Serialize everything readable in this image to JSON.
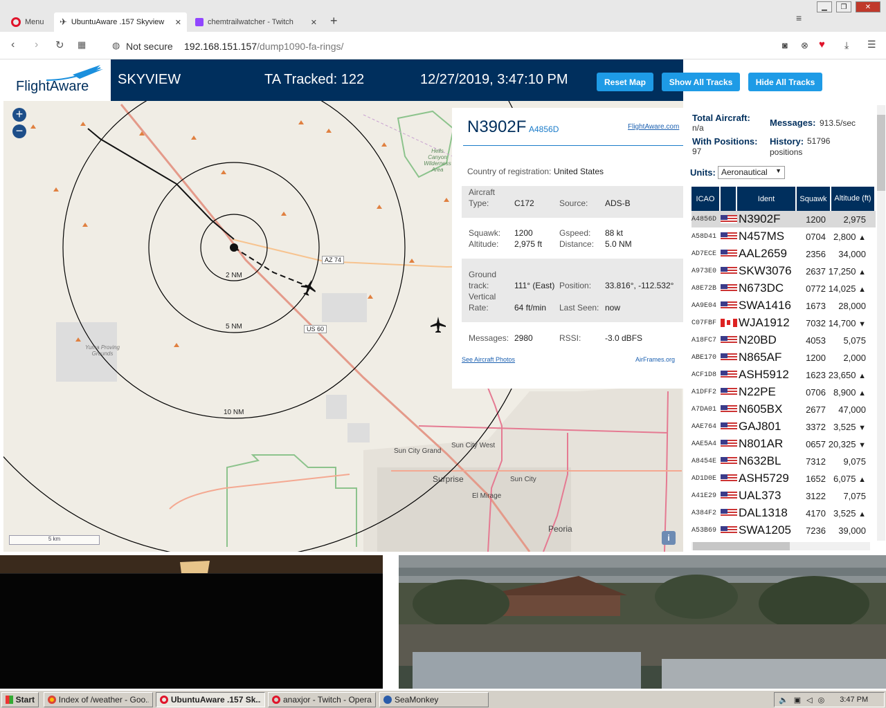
{
  "browser": {
    "menu_label": "Menu",
    "tabs": [
      {
        "label": "UbuntuAware .157 Skyview",
        "active": true
      },
      {
        "label": "chemtrailwatcher - Twitch",
        "active": false
      }
    ],
    "security_label": "Not secure",
    "url_host": "192.168.151.157",
    "url_path": "/dump1090-fa-rings/"
  },
  "header": {
    "logo_text": "FlightAware",
    "title": "SKYVIEW",
    "tracked": "TA Tracked: 122",
    "datetime": "12/27/2019, 3:47:10 PM",
    "buttons": [
      "Reset Map",
      "Show All Tracks",
      "Hide All Tracks"
    ]
  },
  "map": {
    "labels": [
      "2 NM",
      "5 NM",
      "10 NM",
      "AZ 74",
      "US 60",
      "Sun City Grand",
      "Sun City West",
      "Surprise",
      "Sun City",
      "El Mirage",
      "Peoria",
      "Hells Canyon Wilderness Area",
      "Yuma Proving Grounds"
    ],
    "scale": "5 km",
    "info_btn": "i"
  },
  "popup": {
    "callsign": "N3902F",
    "hex": "A4856D",
    "fa_link": "FlightAware.com",
    "country_label": "Country of registration:",
    "country": "United States",
    "aircraft_label": "Aircraft",
    "type_label": "Type:",
    "type": "C172",
    "source_label": "Source:",
    "source": "ADS-B",
    "squawk_label": "Squawk:",
    "squawk": "1200",
    "gspeed_label": "Gspeed:",
    "gspeed": "88 kt",
    "altitude_label": "Altitude:",
    "altitude": "2,975 ft",
    "distance_label": "Distance:",
    "distance": "5.0 NM",
    "ground_label": "Ground",
    "track_label": "track:",
    "track": "111° (East)",
    "position_label": "Position:",
    "position": "33.816°, -112.532°",
    "vertical_label": "Vertical",
    "rate_label": "Rate:",
    "rate": "64 ft/min",
    "lastseen_label": "Last Seen:",
    "lastseen": "now",
    "messages_label": "Messages:",
    "messages": "2980",
    "rssi_label": "RSSI:",
    "rssi": "-3.0 dBFS",
    "photos_link": "See Aircraft Photos",
    "airframes_link": "AirFrames.org"
  },
  "sidebar": {
    "total_label": "Total Aircraft:",
    "total": "n/a",
    "messages_label": "Messages:",
    "messages": "913.5/sec",
    "withpos_label": "With Positions:",
    "withpos": "97",
    "history_label": "History:",
    "history": "51796",
    "history_unit": "positions",
    "units_label": "Units:",
    "units_value": "Aeronautical",
    "columns": [
      "ICAO",
      "",
      "Ident",
      "Squawk",
      "Altitude (ft)"
    ],
    "rows": [
      {
        "icao": "A4856D",
        "flag": "us",
        "ident": "N3902F",
        "squawk": "1200",
        "alt": "2,975",
        "trend": ""
      },
      {
        "icao": "A58D41",
        "flag": "us",
        "ident": "N457MS",
        "squawk": "0704",
        "alt": "2,800",
        "trend": "▲"
      },
      {
        "icao": "AD7ECE",
        "flag": "us",
        "ident": "AAL2659",
        "squawk": "2356",
        "alt": "34,000",
        "trend": ""
      },
      {
        "icao": "A973E0",
        "flag": "us",
        "ident": "SKW3076",
        "squawk": "2637",
        "alt": "17,250",
        "trend": "▲"
      },
      {
        "icao": "A8E72B",
        "flag": "us",
        "ident": "N673DC",
        "squawk": "0772",
        "alt": "14,025",
        "trend": "▲"
      },
      {
        "icao": "AA9E04",
        "flag": "us",
        "ident": "SWA1416",
        "squawk": "1673",
        "alt": "28,000",
        "trend": ""
      },
      {
        "icao": "C07FBF",
        "flag": "ca",
        "ident": "WJA1912",
        "squawk": "7032",
        "alt": "14,700",
        "trend": "▼"
      },
      {
        "icao": "A18FC7",
        "flag": "us",
        "ident": "N20BD",
        "squawk": "4053",
        "alt": "5,075",
        "trend": ""
      },
      {
        "icao": "ABE170",
        "flag": "us",
        "ident": "N865AF",
        "squawk": "1200",
        "alt": "2,000",
        "trend": ""
      },
      {
        "icao": "ACF1D8",
        "flag": "us",
        "ident": "ASH5912",
        "squawk": "1623",
        "alt": "23,650",
        "trend": "▲"
      },
      {
        "icao": "A1DFF2",
        "flag": "us",
        "ident": "N22PE",
        "squawk": "0706",
        "alt": "8,900",
        "trend": "▲"
      },
      {
        "icao": "A7DA01",
        "flag": "us",
        "ident": "N605BX",
        "squawk": "2677",
        "alt": "47,000",
        "trend": ""
      },
      {
        "icao": "AAE764",
        "flag": "us",
        "ident": "GAJ801",
        "squawk": "3372",
        "alt": "3,525",
        "trend": "▼"
      },
      {
        "icao": "AAE5A4",
        "flag": "us",
        "ident": "N801AR",
        "squawk": "0657",
        "alt": "20,325",
        "trend": "▼"
      },
      {
        "icao": "A8454E",
        "flag": "us",
        "ident": "N632BL",
        "squawk": "7312",
        "alt": "9,075",
        "trend": ""
      },
      {
        "icao": "AD1D0E",
        "flag": "us",
        "ident": "ASH5729",
        "squawk": "1652",
        "alt": "6,075",
        "trend": "▲"
      },
      {
        "icao": "A41E29",
        "flag": "us",
        "ident": "UAL373",
        "squawk": "3122",
        "alt": "7,075",
        "trend": ""
      },
      {
        "icao": "A384F2",
        "flag": "us",
        "ident": "DAL1318",
        "squawk": "4170",
        "alt": "3,525",
        "trend": "▲"
      },
      {
        "icao": "A53B69",
        "flag": "us",
        "ident": "SWA1205",
        "squawk": "7236",
        "alt": "39,000",
        "trend": ""
      }
    ]
  },
  "taskbar": {
    "start": "Start",
    "items": [
      "Index of /weather - Goo...",
      "UbuntuAware .157 Sk...",
      "anaxjor - Twitch - Opera",
      "SeaMonkey"
    ],
    "clock": "3:47 PM"
  },
  "colors": {
    "header_bg": "#002f5d",
    "button_bg": "#1e9be6",
    "accent": "#1a6fb0"
  }
}
